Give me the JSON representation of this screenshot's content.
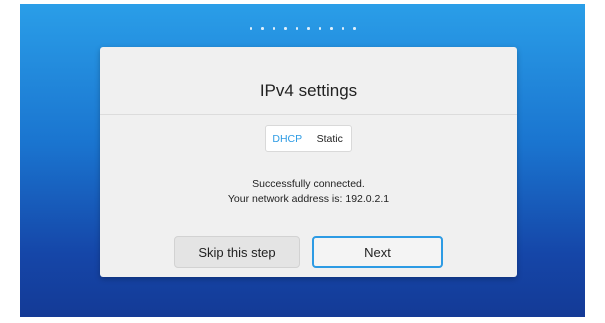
{
  "wizard": {
    "total_steps": 10,
    "dialog": {
      "title": "IPv4 settings",
      "mode_toggle": {
        "options": [
          "DHCP",
          "Static"
        ],
        "selected": "DHCP"
      },
      "status_line1": "Successfully connected.",
      "status_line2": "Your network address is: 192.0.2.1",
      "skip_label": "Skip this step",
      "next_label": "Next"
    }
  },
  "colors": {
    "accent": "#2d9be4",
    "background_top": "#2a9ee8",
    "background_bottom": "#143a96",
    "dialog_bg": "#f0f0f0"
  }
}
